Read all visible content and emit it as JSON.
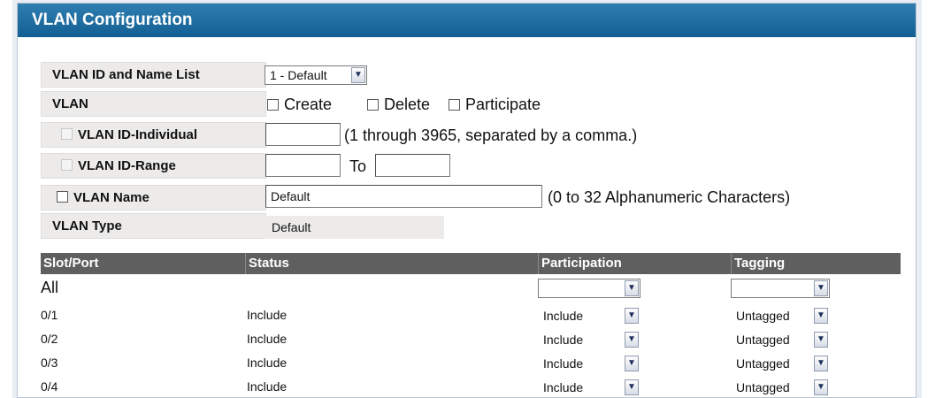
{
  "title": "VLAN Configuration",
  "fields": {
    "vlan_id_name_list": {
      "label": "VLAN ID and Name List",
      "selected": "1 - Default"
    },
    "vlan": {
      "label": "VLAN",
      "options": [
        "Create",
        "Delete",
        "Participate"
      ]
    },
    "vlan_id_individual": {
      "label": "VLAN ID-Individual",
      "value": "",
      "hint": "(1 through 3965, separated by a comma.)"
    },
    "vlan_id_range": {
      "label": "VLAN ID-Range",
      "from": "",
      "to_label": "To",
      "to": ""
    },
    "vlan_name": {
      "label": "VLAN Name",
      "value": "Default",
      "hint": "(0 to 32 Alphanumeric Characters)"
    },
    "vlan_type": {
      "label": "VLAN Type",
      "value": "Default"
    }
  },
  "table": {
    "columns": [
      "Slot/Port",
      "Status",
      "Participation",
      "Tagging"
    ],
    "all_row": {
      "label": "All",
      "participation": "",
      "tagging": ""
    },
    "rows": [
      {
        "port": "0/1",
        "status": "Include",
        "participation": "Include",
        "tagging": "Untagged"
      },
      {
        "port": "0/2",
        "status": "Include",
        "participation": "Include",
        "tagging": "Untagged"
      },
      {
        "port": "0/3",
        "status": "Include",
        "participation": "Include",
        "tagging": "Untagged"
      },
      {
        "port": "0/4",
        "status": "Include",
        "participation": "Include",
        "tagging": "Untagged"
      }
    ]
  },
  "colors": {
    "title_bar": "#1f6fa3",
    "header_bg": "#5f5f5f",
    "label_bg": "#ecebea"
  },
  "icons": {
    "dropdown": "chevron-down-icon",
    "checkbox": "checkbox-icon"
  }
}
